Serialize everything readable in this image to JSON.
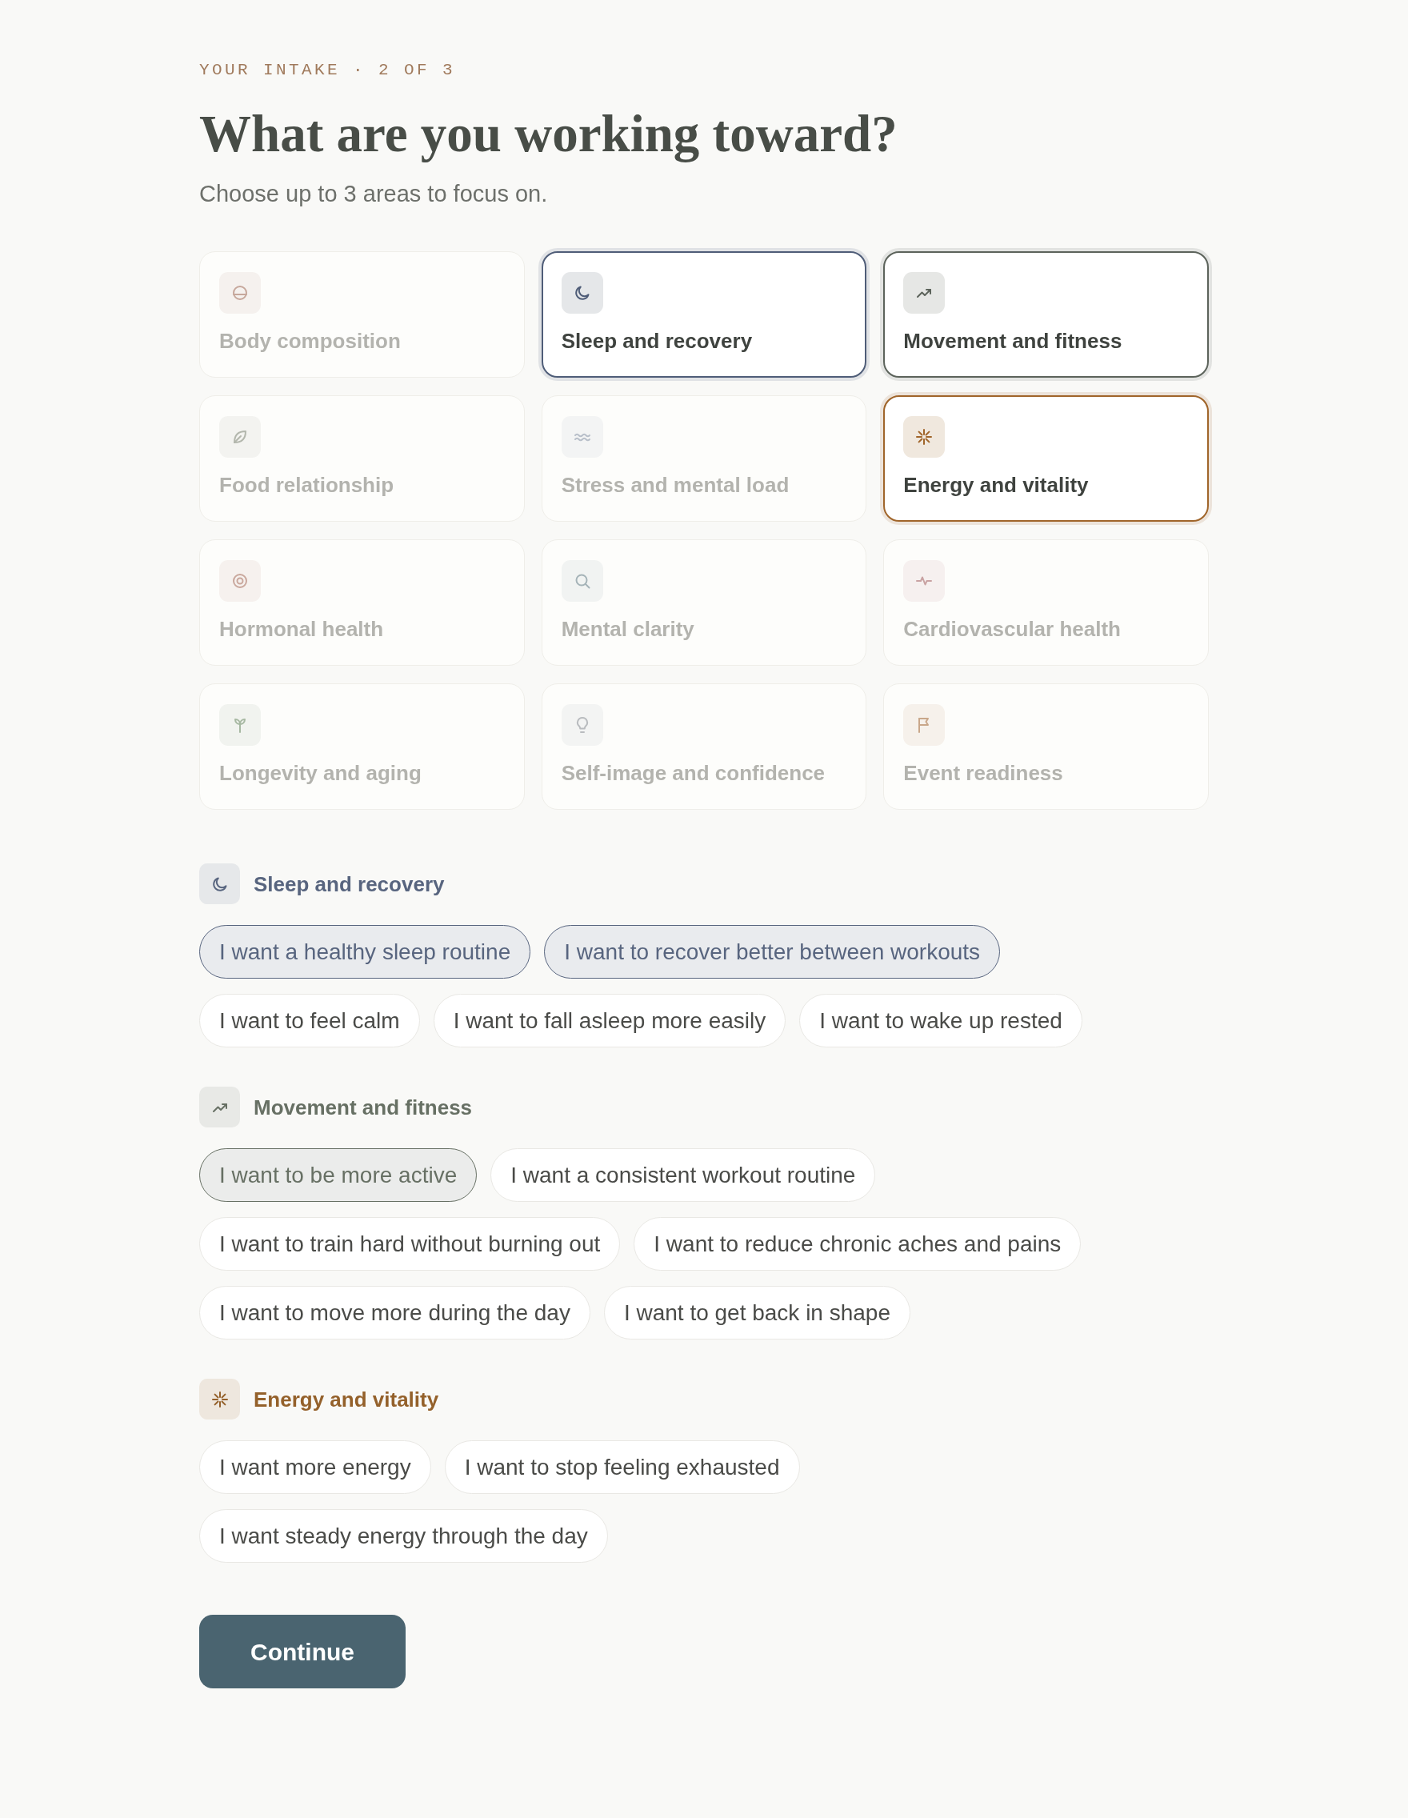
{
  "eyebrow": "YOUR INTAKE · 2 OF 3",
  "title": "What are you working toward?",
  "subtitle": "Choose up to 3 areas to focus on.",
  "areas": [
    {
      "label": "Body composition",
      "kind": "body",
      "color": "#c6a79b",
      "selected": false
    },
    {
      "label": "Sleep and recovery",
      "kind": "sleep",
      "color": "#4f5d78",
      "selected": true
    },
    {
      "label": "Movement and fitness",
      "kind": "movement",
      "color": "#5c635b",
      "selected": true
    },
    {
      "label": "Food relationship",
      "kind": "food",
      "color": "#b3b7ad",
      "selected": false
    },
    {
      "label": "Stress and mental load",
      "kind": "stress",
      "color": "#b8bfc9",
      "selected": false
    },
    {
      "label": "Energy and vitality",
      "kind": "energy",
      "color": "#a0652a",
      "selected": true
    },
    {
      "label": "Hormonal health",
      "kind": "hormonal",
      "color": "#c9a79c",
      "selected": false
    },
    {
      "label": "Mental clarity",
      "kind": "clarity",
      "color": "#a5b3b8",
      "selected": false
    },
    {
      "label": "Cardiovascular health",
      "kind": "cardio",
      "color": "#c9a3a3",
      "selected": false
    },
    {
      "label": "Longevity and aging",
      "kind": "longevity",
      "color": "#a7b8a2",
      "selected": false
    },
    {
      "label": "Self-image and confidence",
      "kind": "selfimage",
      "color": "#b9bcbf",
      "selected": false
    },
    {
      "label": "Event readiness",
      "kind": "event",
      "color": "#c9a78a",
      "selected": false
    }
  ],
  "sections": [
    {
      "title": "Sleep and recovery",
      "kind": "sleep",
      "color": "#58657f",
      "options": [
        {
          "label": "I want a healthy sleep routine",
          "selected": true
        },
        {
          "label": "I want to recover better between workouts",
          "selected": true
        },
        {
          "label": "I want to feel calm",
          "selected": false
        },
        {
          "label": "I want to fall asleep more easily",
          "selected": false
        },
        {
          "label": "I want to wake up rested",
          "selected": false
        }
      ]
    },
    {
      "title": "Movement and fitness",
      "kind": "movement",
      "color": "#677064",
      "options": [
        {
          "label": "I want to be more active",
          "selected": true
        },
        {
          "label": "I want a consistent workout routine",
          "selected": false
        },
        {
          "label": "I want to train hard without burning out",
          "selected": false
        },
        {
          "label": "I want to reduce chronic aches and pains",
          "selected": false
        },
        {
          "label": "I want to move more during the day",
          "selected": false
        },
        {
          "label": "I want to get back in shape",
          "selected": false
        }
      ]
    },
    {
      "title": "Energy and vitality",
      "kind": "energy",
      "color": "#94612b",
      "options": [
        {
          "label": "I want more energy",
          "selected": false
        },
        {
          "label": "I want to stop feeling exhausted",
          "selected": false
        },
        {
          "label": "I want steady energy through the day",
          "selected": false
        }
      ]
    }
  ],
  "continue_button": "Continue"
}
